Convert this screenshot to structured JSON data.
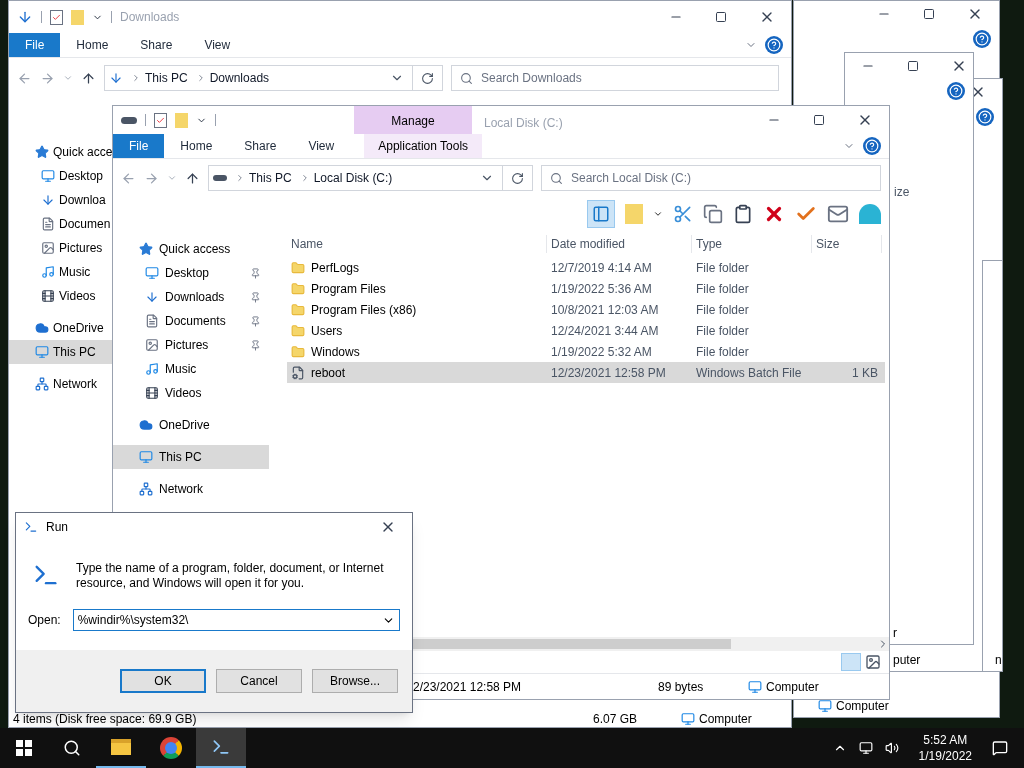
{
  "back_window": {
    "title": "Downloads",
    "ribbon_tabs": [
      {
        "label": "File",
        "selected": true
      },
      {
        "label": "Home",
        "selected": false
      },
      {
        "label": "Share",
        "selected": false
      },
      {
        "label": "View",
        "selected": false
      }
    ],
    "address": [
      "This PC",
      "Downloads"
    ],
    "search": {
      "placeholder": "Search Downloads"
    },
    "nav": [
      {
        "label": "Quick acce",
        "kind": "star",
        "selected": false
      },
      {
        "label": "Desktop",
        "kind": "desktop",
        "selected": false
      },
      {
        "label": "Downloa",
        "kind": "download",
        "selected": false
      },
      {
        "label": "Documen",
        "kind": "document",
        "selected": false
      },
      {
        "label": "Pictures",
        "kind": "picture",
        "selected": false
      },
      {
        "label": "Music",
        "kind": "music",
        "selected": false
      },
      {
        "label": "Videos",
        "kind": "video",
        "selected": false
      },
      {
        "label": "OneDrive",
        "kind": "cloud",
        "selected": false
      },
      {
        "label": "This PC",
        "kind": "pc",
        "selected": true
      },
      {
        "label": "Network",
        "kind": "network",
        "selected": false
      }
    ],
    "status": "4 items (Disk free space: 69.9 GB)",
    "status_size": "6.07 GB",
    "status_location": "Computer"
  },
  "stacked_windows": [
    {
      "status": "Computer"
    },
    {
      "status": "puter"
    },
    {
      "status": "n"
    },
    {
      "header": "ize",
      "status": "r"
    }
  ],
  "front_window": {
    "title": "Local Disk (C:)",
    "context_tab": "Manage",
    "context_group": "Application Tools",
    "ribbon_tabs": [
      {
        "label": "File",
        "selected": true
      },
      {
        "label": "Home",
        "selected": false
      },
      {
        "label": "Share",
        "selected": false
      },
      {
        "label": "View",
        "selected": false
      }
    ],
    "address": [
      "This PC",
      "Local Disk (C:)"
    ],
    "search": {
      "placeholder": "Search Local Disk (C:)"
    },
    "nav": [
      {
        "label": "Quick access",
        "kind": "star",
        "selected": false,
        "children": [
          {
            "label": "Desktop",
            "kind": "desktop",
            "pinned": true,
            "selected": false
          },
          {
            "label": "Downloads",
            "kind": "download",
            "pinned": true,
            "selected": false
          },
          {
            "label": "Documents",
            "kind": "document",
            "pinned": true,
            "selected": false
          },
          {
            "label": "Pictures",
            "kind": "picture",
            "pinned": true,
            "selected": false
          },
          {
            "label": "Music",
            "kind": "music",
            "pinned": false,
            "selected": false
          },
          {
            "label": "Videos",
            "kind": "video",
            "pinned": false,
            "selected": false
          }
        ]
      },
      {
        "label": "OneDrive",
        "kind": "cloud",
        "selected": false
      },
      {
        "label": "This PC",
        "kind": "pc",
        "selected": true
      },
      {
        "label": "Network",
        "kind": "network",
        "selected": false
      }
    ],
    "columns": [
      "Name",
      "Date modified",
      "Type",
      "Size"
    ],
    "rows": [
      {
        "name": "PerfLogs",
        "date": "12/7/2019 4:14 AM",
        "type": "File folder",
        "kind": "folder",
        "selected": false
      },
      {
        "name": "Program Files",
        "date": "1/19/2022 5:36 AM",
        "type": "File folder",
        "kind": "folder",
        "selected": false
      },
      {
        "name": "Program Files (x86)",
        "date": "10/8/2021 12:03 AM",
        "type": "File folder",
        "kind": "folder",
        "selected": false
      },
      {
        "name": "Users",
        "date": "12/24/2021 3:44 AM",
        "type": "File folder",
        "kind": "folder",
        "selected": false
      },
      {
        "name": "Windows",
        "date": "1/19/2022 5:32 AM",
        "type": "File folder",
        "kind": "folder",
        "selected": false
      },
      {
        "name": "reboot",
        "date": "12/23/2021 12:58 PM",
        "type": "Windows Batch File",
        "size": "1 KB",
        "kind": "batch",
        "selected": true
      }
    ],
    "status_date": "2/23/2021 12:58 PM",
    "status_size": "89 bytes",
    "status_location": "Computer"
  },
  "run_dialog": {
    "title": "Run",
    "description": "Type the name of a program, folder, document, or Internet resource, and Windows will open it for you.",
    "open_label": "Open:",
    "value": "%windir%\\system32\\",
    "buttons": [
      {
        "label": "OK",
        "default": true
      },
      {
        "label": "Cancel",
        "default": false
      },
      {
        "label": "Browse...",
        "default": false
      }
    ]
  },
  "taskbar": {
    "apps": [
      {
        "kind": "explorer",
        "active": false,
        "running": true
      },
      {
        "kind": "chrome",
        "active": false,
        "running": false
      },
      {
        "kind": "run",
        "active": true,
        "running": true
      }
    ],
    "time": "5:52 AM",
    "date": "1/19/2022"
  }
}
